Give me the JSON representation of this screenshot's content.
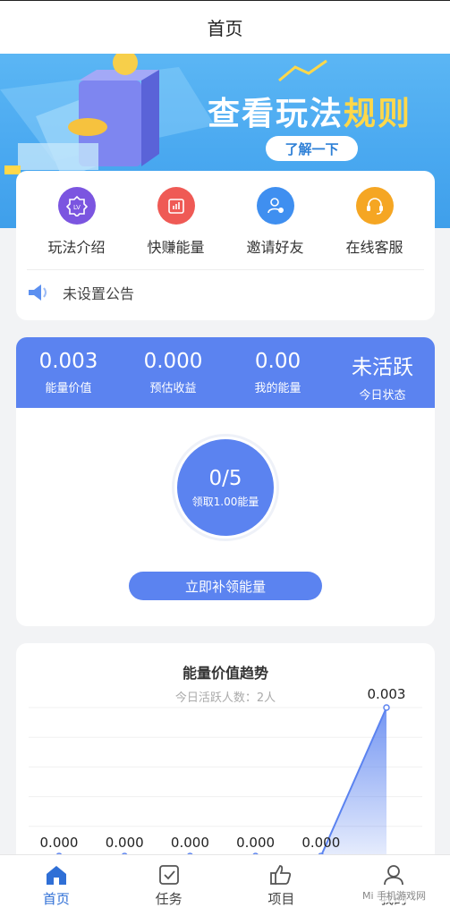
{
  "header": {
    "title": "首页"
  },
  "banner": {
    "title_main": "查看玩法",
    "title_highlight": "规则",
    "button_label": "了解一下"
  },
  "quick_actions": [
    {
      "label": "玩法介绍",
      "icon": "level-badge-icon",
      "color": "#7b55e0"
    },
    {
      "label": "快赚能量",
      "icon": "chart-box-icon",
      "color": "#ef5a55"
    },
    {
      "label": "邀请好友",
      "icon": "user-heart-icon",
      "color": "#3f8ff0"
    },
    {
      "label": "在线客服",
      "icon": "headset-icon",
      "color": "#f5a623"
    }
  ],
  "notice": {
    "text": "未设置公告"
  },
  "stats": [
    {
      "value": "0.003",
      "label": "能量价值"
    },
    {
      "value": "0.000",
      "label": "预估收益"
    },
    {
      "value": "0.00",
      "label": "我的能量"
    },
    {
      "value": "未活跃",
      "label": "今日状态"
    }
  ],
  "claim": {
    "count": "0/5",
    "sub": "领取1.00能量",
    "button_label": "立即补领能量"
  },
  "trend": {
    "title": "能量价值趋势",
    "subtitle": "今日活跃人数：2人"
  },
  "chart_data": {
    "type": "area",
    "title": "能量价值趋势",
    "x": [
      "",
      "",
      "",
      "",
      "",
      ""
    ],
    "values": [
      0.0,
      0.0,
      0.0,
      0.0,
      0.0,
      0.003
    ],
    "data_labels": [
      "0.000",
      "0.000",
      "0.000",
      "0.000",
      "0.000",
      "0.003"
    ],
    "ylim": [
      0,
      0.003
    ],
    "grid": true,
    "color": "#5b83f0"
  },
  "tabbar": [
    {
      "label": "首页",
      "icon": "home-icon",
      "active": true
    },
    {
      "label": "任务",
      "icon": "task-check-icon",
      "active": false
    },
    {
      "label": "项目",
      "icon": "thumbs-up-icon",
      "active": false
    },
    {
      "label": "我的",
      "icon": "user-icon",
      "active": false
    }
  ],
  "watermark": "Mi 手机游戏网"
}
